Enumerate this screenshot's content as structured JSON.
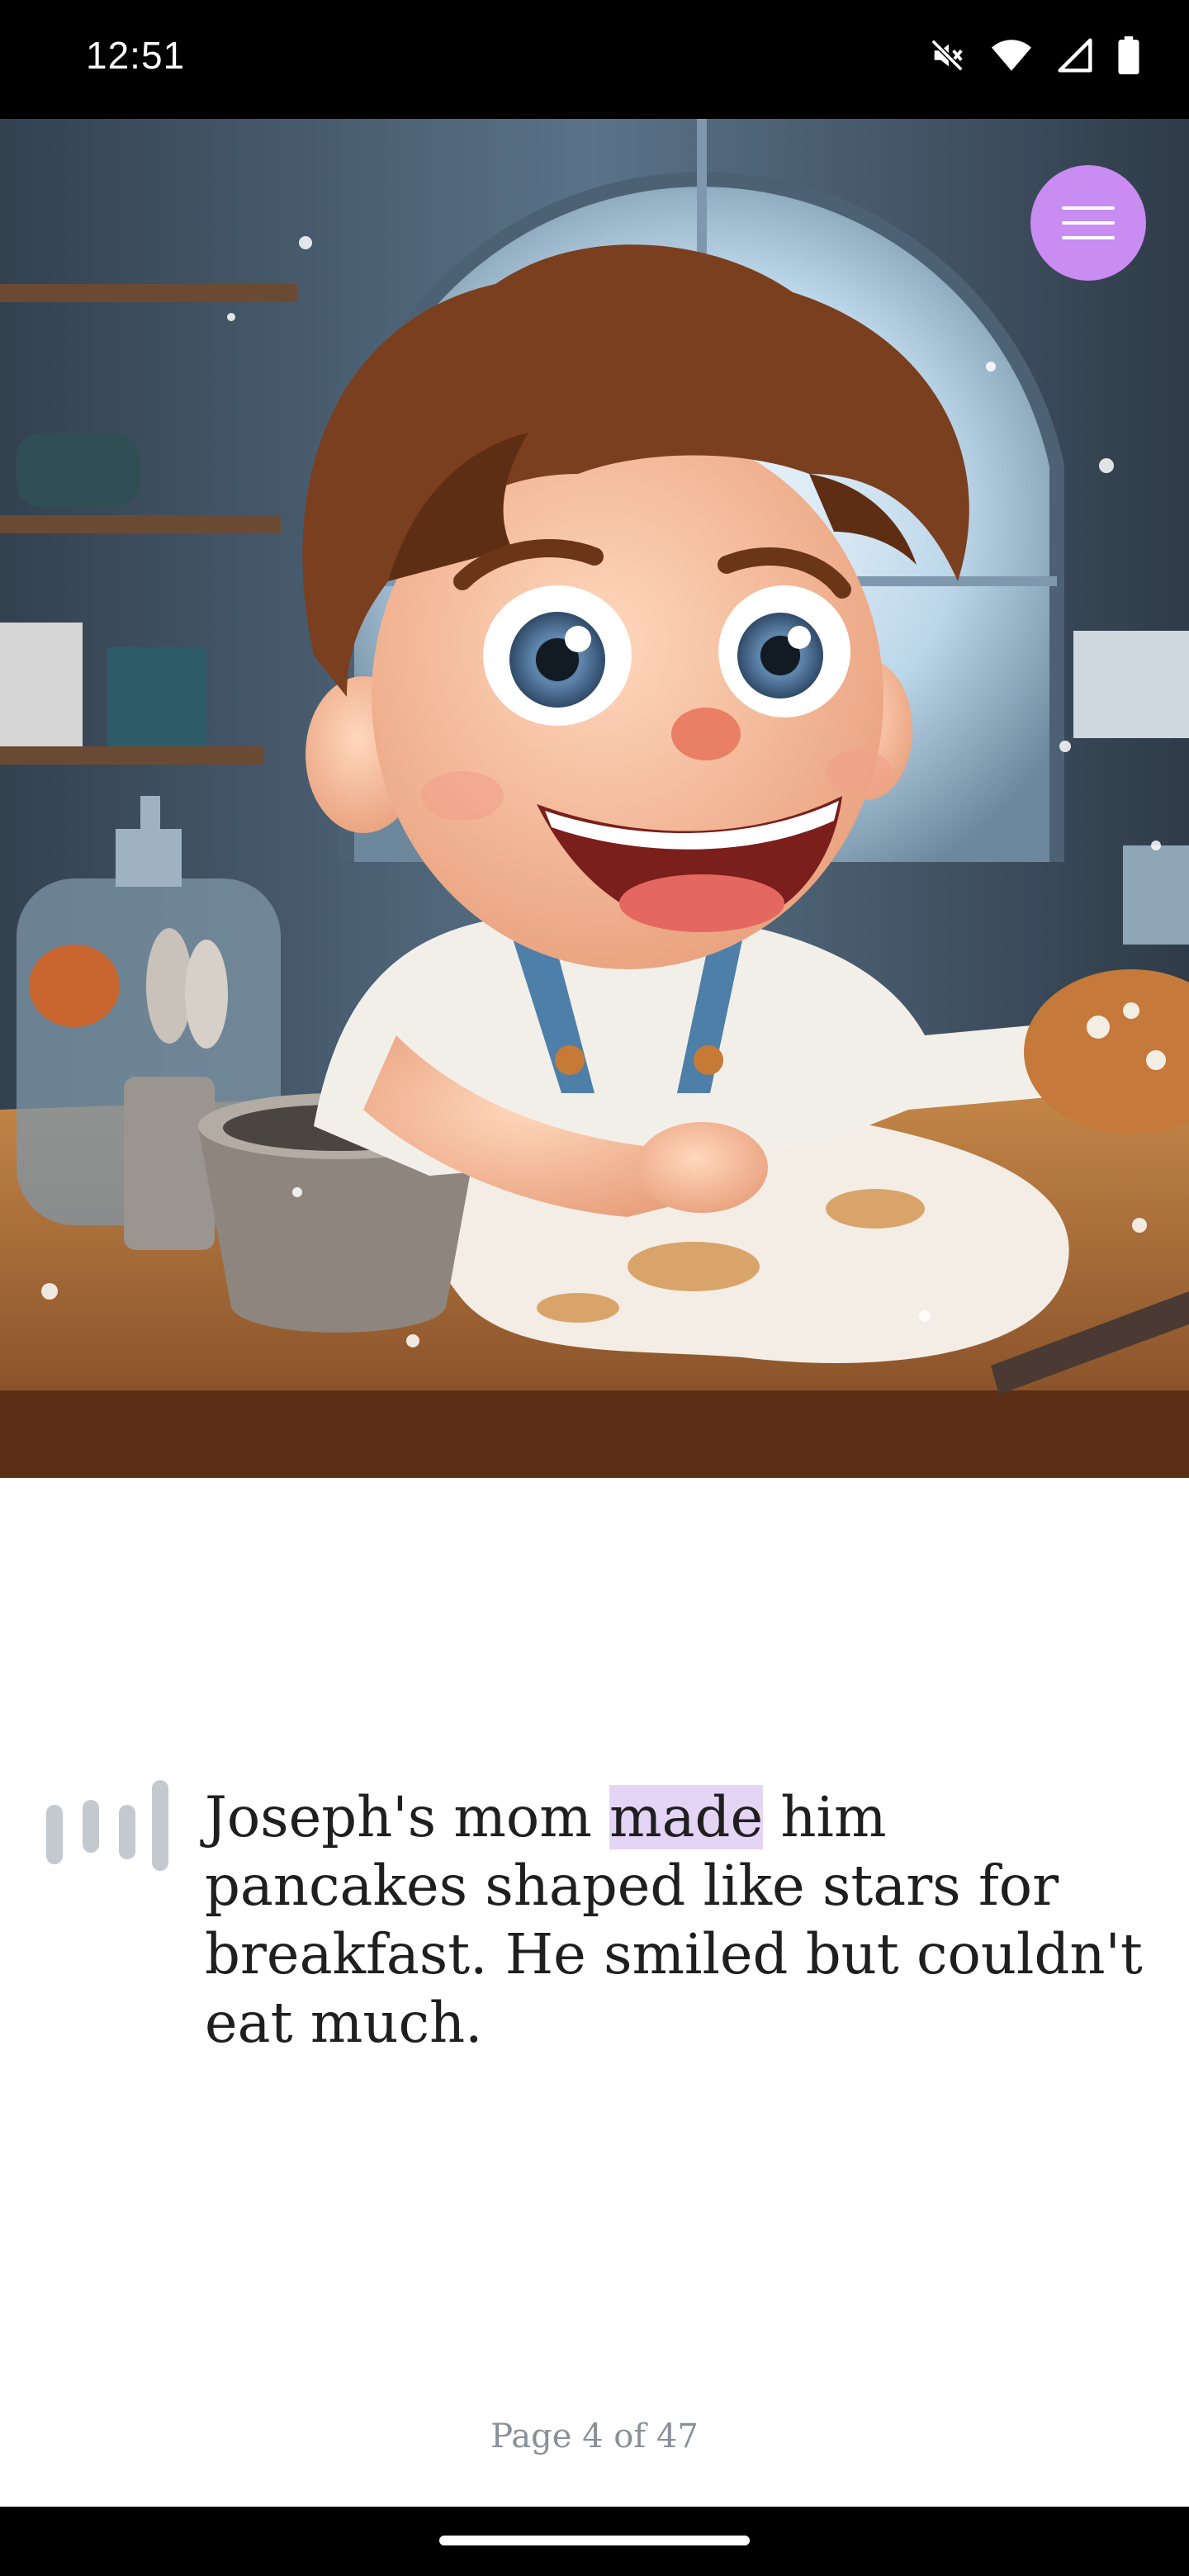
{
  "status_bar": {
    "time": "12:51"
  },
  "menu": {
    "icon": "hamburger-menu-icon",
    "color": "#c88cf2"
  },
  "story": {
    "text_before": "Joseph's mom ",
    "highlighted_word": "made",
    "text_after": " him pancakes shaped like stars for breakfast. He smiled but couldn't eat much."
  },
  "pagination": {
    "label": "Page 4 of 47"
  },
  "colors": {
    "highlight": "#e4d4f6",
    "accent": "#c88cf2"
  }
}
